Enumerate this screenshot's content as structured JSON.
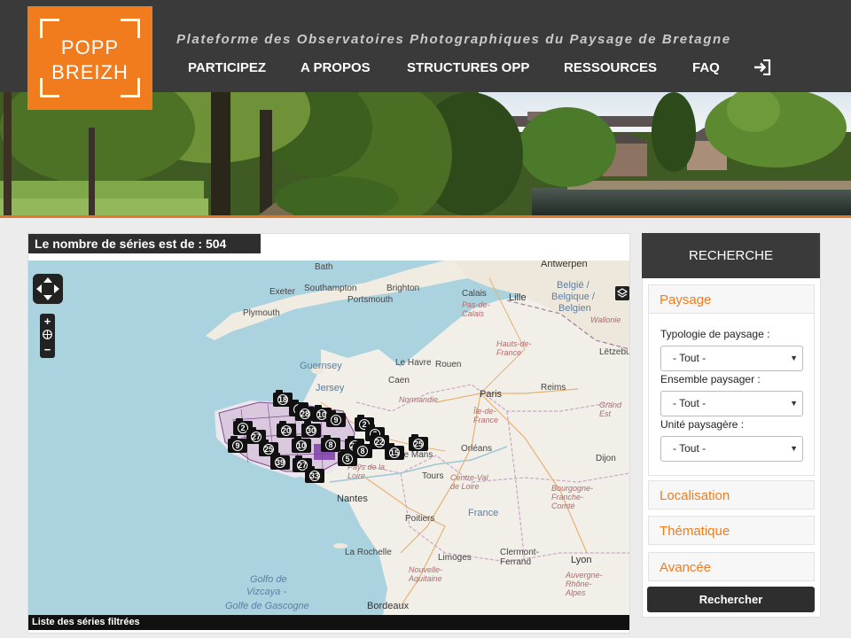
{
  "header": {
    "logo_line1": "POPP",
    "logo_line2": "BREIZH",
    "tagline": "Plateforme des Observatoires Photographiques du Paysage de Bretagne",
    "nav": [
      {
        "label": "PARTICIPEZ"
      },
      {
        "label": "A PROPOS"
      },
      {
        "label": "STRUCTURES OPP"
      },
      {
        "label": "RESSOURCES"
      },
      {
        "label": "FAQ"
      }
    ],
    "login_icon": "sign-in-icon"
  },
  "colors": {
    "brand_orange": "#f07c1e",
    "header_bg": "#3a3a3a",
    "dark_button": "#2e2e2e"
  },
  "results": {
    "count_text": "Le nombre de séries est de : 504",
    "list_title": "Liste des séries filtrées"
  },
  "map": {
    "labels": {
      "antwerpen": "Antwerpen",
      "bath": "Bath",
      "exeter": "Exeter",
      "southampton": "Southampton",
      "brighton": "Brighton",
      "plymouth": "Plymouth",
      "portsmouth": "Portsmouth",
      "calais": "Calais",
      "lille": "Lille",
      "pas_de_calais": "Pas-de-\nCalais",
      "belgie1": "België /",
      "belgie2": "Belgique /",
      "belgie3": "Belgien",
      "wallonie": "Wallonie",
      "hauts_de_france": "Hauts-de-\nFrance",
      "guernsey": "Guernsey",
      "jersey": "Jersey",
      "le_havre": "Le Havre",
      "rouen": "Rouen",
      "caen": "Caen",
      "normandie": "Normandie",
      "paris": "Paris",
      "reims": "Reims",
      "ile_de_france": "Île-de-\nFrance",
      "grand_est": "Grand\nEst",
      "letzebuerg": "Lëtzebu",
      "le_mans": "Le Mans",
      "orleans": "Orléans",
      "tours": "Tours",
      "centre_val_de_loire": "Centre-Val\nde Loire",
      "pays_de_la_loire": "Pays de la\nLoire",
      "nantes": "Nantes",
      "bourgogne": "Bourgogne-\nFranche-\nComté",
      "dijon": "Dijon",
      "france": "France",
      "poitiers": "Poitiers",
      "la_rochelle": "La Rochelle",
      "limoges": "Limoges",
      "nouvelle_aquitaine": "Nouvelle-\nAquitaine",
      "clermont": "Clermont-\nFerrand",
      "lyon": "Lyon",
      "auvergne": "Auvergne-\nRhône-\nAlpes",
      "golfo1": "Golfo de",
      "golfo2": "Vizcaya -",
      "golfo3": "Golfe de Gascogne",
      "bordeaux": "Bordeaux"
    },
    "markers": [
      "18",
      "2",
      "28",
      "10",
      "9",
      "2",
      "2",
      "20",
      "27",
      "2",
      "9",
      "30",
      "10",
      "8",
      "28",
      "22",
      "5",
      "25",
      "25",
      "39",
      "27",
      "8",
      "15",
      "33"
    ],
    "controls": {
      "pan_icon": "pan-arrows-icon",
      "zoom_in": "+",
      "zoom_out": "−",
      "globe_icon": "globe-icon",
      "layers_icon": "layers-icon"
    }
  },
  "sidebar": {
    "title": "RECHERCHE",
    "sections": {
      "paysage": "Paysage",
      "localisation": "Localisation",
      "thematique": "Thématique",
      "avancee": "Avancée"
    },
    "filters": {
      "typologie_label": "Typologie de paysage :",
      "typologie_value": "- Tout -",
      "ensemble_label": "Ensemble paysager :",
      "ensemble_value": "- Tout -",
      "unite_label": "Unité paysagère :",
      "unite_value": "- Tout -"
    },
    "search_button": "Rechercher"
  }
}
